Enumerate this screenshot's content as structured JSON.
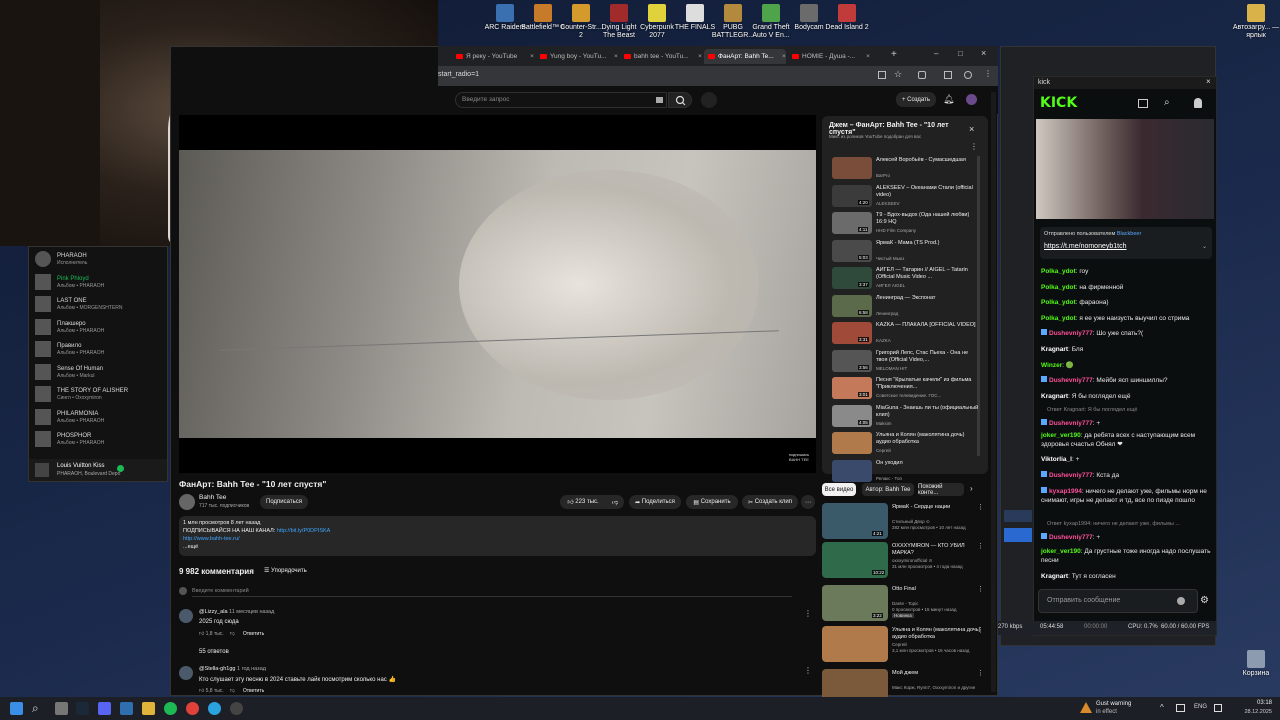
{
  "desktop": {
    "icons": [
      {
        "label": "ARC Raiders",
        "color": "#3a6fb0"
      },
      {
        "label": "Battlefield™ 6",
        "color": "#c77b2a"
      },
      {
        "label": "Counter-Str... 2",
        "color": "#d49a2b"
      },
      {
        "label": "Dying Light The Beast",
        "color": "#a12a2a"
      },
      {
        "label": "Cyberpunk 2077",
        "color": "#e0d23a"
      },
      {
        "label": "THE FINALS",
        "color": "#dddddd"
      },
      {
        "label": "PUBG BATTLEGR...",
        "color": "#b38a3d"
      },
      {
        "label": "Grand Theft Auto V En...",
        "color": "#4fa34a"
      },
      {
        "label": "Bodycam",
        "color": "#6b6b6b"
      },
      {
        "label": "Dead Island 2",
        "color": "#c23b3b"
      }
    ],
    "right_icon_label": "Автозагру... — ярлык",
    "trash_label": "Корзина"
  },
  "spotify": {
    "items": [
      {
        "title": "PHARAOH",
        "sub": "Исполнитель"
      },
      {
        "title": "Pink Phloyd",
        "sub": "Альбом • PHARAOH"
      },
      {
        "title": "LAST ONE",
        "sub": "Альбом • MORGENSHTERN"
      },
      {
        "title": "Плакшеро",
        "sub": "Альбом • PHARAOH"
      },
      {
        "title": "Правило",
        "sub": "Альбом • PHARAOH"
      },
      {
        "title": "Sense Of Human",
        "sub": "Альбом • Markul"
      },
      {
        "title": "THE STORY OF ALISHER",
        "sub": "Сингл • Oxxxymiron"
      },
      {
        "title": "PHILARMONIA",
        "sub": "Альбом • PHARAOH"
      },
      {
        "title": "PHOSPHOR",
        "sub": "Альбом • PHARAOH"
      }
    ],
    "now_playing": {
      "title": "Louis Vuitton Kiss",
      "artist": "PHARAOH, Boulevard Depo"
    }
  },
  "browser": {
    "tabs": [
      {
        "label": "Я реку - YouTube"
      },
      {
        "label": "Yung boy - YouTu..."
      },
      {
        "label": "bahh tee - YouTu..."
      },
      {
        "label": "ФанАрт: Bahh Te...",
        "active": true
      },
      {
        "label": "HOMIE - Душа -..."
      }
    ],
    "url": "start_radio=1",
    "search_placeholder": "Введите запрос",
    "create_label": "Создать"
  },
  "video": {
    "title": "ФанАрт: Bahh Tee - \"10 лет спустя\"",
    "channel": "Bahh Tee",
    "subs": "717 тыс. подписчиков",
    "subscribe": "Подписаться",
    "likes": "223 тыс.",
    "share": "Поделиться",
    "save": "Сохранить",
    "clip": "Создать клип",
    "watermark": "подпишись BAHH TEE",
    "desc_meta": "1 млн просмотров  8 лет назад",
    "desc_line": "ПОДПИСЫВАЙСЯ НА НАШ КАНАЛ:",
    "desc_link1": "http://bit.ly/P0DPISKA",
    "desc_link2": "http://www.bahh-tee.ru/",
    "desc_more": "...ещё",
    "comments_count": "9 982 комментария",
    "sort": "Упорядочить",
    "add_comment": "Введите комментарий",
    "comments": [
      {
        "author": "@Lizzy_ala",
        "time": "11 месяцев назад",
        "text": "2025 год сюда",
        "likes": "1,8 тыс.",
        "reply": "Ответить",
        "replies": "55 ответов"
      },
      {
        "author": "@Stella-gh1gg",
        "time": "1 год назад",
        "text": "Кто слушает эту песню в 2024 ставьте лайк посмотрим сколько нас 👍",
        "likes": "5,8 тыс.",
        "reply": "Ответить"
      }
    ]
  },
  "playlist": {
    "title": "Джем – ФанАрт: Bahh Tee - \"10 лет спустя\"",
    "subtitle": "Микс из роликов YouTube подобран для вас",
    "items": [
      {
        "title": "Алексей Воробьёв - Сумасшедшая",
        "channel": "BarPro",
        "dur": "",
        "color": "#7a4c3a"
      },
      {
        "title": "ALEKSEEV – Океанами Стали (official video)",
        "channel": "ALEKSEEV",
        "dur": "4:20",
        "color": "#3b3b3b"
      },
      {
        "title": "T9 - Вдох-выдох (Ода нашей любви) 16:9 HQ",
        "channel": "HHD Film Company",
        "dur": "4:11",
        "color": "#6b6b6b"
      },
      {
        "title": "ЯрмаК - Мама (TS Prod.)",
        "channel": "Чистый Мьюз",
        "dur": "5:03",
        "color": "#4a4a4a"
      },
      {
        "title": "АИГЕЛ — Татарин // AIGEL – Tatarin (Official Music Video ...",
        "channel": "АИГЕЛ AIGEL",
        "dur": "3:37",
        "color": "#2f4a3a"
      },
      {
        "title": "Ленинград — Экспонат",
        "channel": "Ленинград",
        "dur": "6:58",
        "color": "#5a6a4a"
      },
      {
        "title": "KAZKA — ПЛАКАЛА [OFFICIAL VIDEO]",
        "channel": "KAZKA",
        "dur": "3:31",
        "color": "#a04a3a"
      },
      {
        "title": "Григорий Лепс, Стас Пьеха - Она не твоя (Official Video,...",
        "channel": "MELOMAN HIT",
        "dur": "3:56",
        "color": "#555"
      },
      {
        "title": "Песня \"Крылатые качели\" из фильма \"Приключения...",
        "channel": "Советское телевидение. ГОС...",
        "dur": "3:01",
        "color": "#c47a5a"
      },
      {
        "title": "MiaGuna - Знаешь ли ты (официальный клип)",
        "channel": "Maksim",
        "dur": "4:05",
        "color": "#8a8a8a"
      },
      {
        "title": "Ульяна и Колян (маколятина дочь) аудио обработка",
        "channel": "Сергей",
        "dur": "",
        "color": "#b07a4a"
      },
      {
        "title": "Он уходил",
        "channel": "Релакс - Топ",
        "dur": "",
        "color": "#3a4a6a"
      }
    ]
  },
  "recommend": {
    "chips": [
      "Все видео",
      "Автор: Bahh Tee",
      "Похожий конте..."
    ],
    "items": [
      {
        "title": "ЯрмаК - Сердце нации",
        "meta1": "Стильный Двор ⊙",
        "meta2": "282 млн просмотров • 10 лет назад",
        "dur": "4:21",
        "color": "#3a5a6a"
      },
      {
        "title": "OXXXYMIRON — КТО УБИЛ МАРКА?",
        "meta1": "oxxxymironofficial ⊙",
        "meta2": "31 млн просмотров • 4 года назад",
        "dur": "10:22",
        "color": "#2f6a4a"
      },
      {
        "title": "Otto Final",
        "meta1": "Dante - Topic",
        "meta2": "0 просмотров • 15 минут назад",
        "dur": "3:22",
        "color": "#6a7a5a",
        "badge": "Новинка"
      },
      {
        "title": "Ульяна и Колян (маколятина дочь) аудио обработка",
        "meta1": "Сергей",
        "meta2": "3,1 млн просмотров • 16 часов назад",
        "dur": "",
        "color": "#b07a4a"
      },
      {
        "title": "Мой джем",
        "meta1": "Макс Корж, Rynn7, Oxxxymiron и другие",
        "meta2": "",
        "dur": "",
        "color": "#7a5a3a"
      }
    ]
  },
  "kick": {
    "window_title": "kick",
    "brand": "KICK",
    "pinned_label": "Отправлено пользователем",
    "pinned_user": "Blackbeer",
    "pinned_link": "https://t.me/nomoneyb1tch",
    "messages": [
      {
        "user": "Polka_ydot",
        "color": "g",
        "text": "гоу"
      },
      {
        "user": "Polka_ydot",
        "color": "g",
        "text": "на фирменной"
      },
      {
        "user": "Polka_ydot",
        "color": "g",
        "text": "фараона)"
      },
      {
        "user": "Polka_ydot",
        "color": "g",
        "text": "я ее уже наизусть выучил со стрима"
      },
      {
        "user": "Dushevniy777",
        "color": "p",
        "text": "Шо уже спать?("
      },
      {
        "user": "Kragnart",
        "color": "w",
        "text": "Бля"
      },
      {
        "user": "Winzer",
        "color": "g",
        "text": "🟢"
      },
      {
        "user": "Dushevniy777",
        "color": "p",
        "text": "Мейби ясп шиншиллы?"
      },
      {
        "user": "Kragnart",
        "color": "w",
        "text": "Я бы поглядел ещё"
      },
      {
        "reply": "Ответ Kragnart: Я бы поглядел ещё"
      },
      {
        "user": "Dushevniy777",
        "color": "p",
        "text": "+"
      },
      {
        "user": "joker_ver190",
        "color": "g",
        "text": "да ребята всех с наступающим всем здоровья счастья Обнял ❤"
      },
      {
        "user": "Viktorlia_I",
        "color": "w",
        "text": "+"
      },
      {
        "user": "Dushevniy777",
        "color": "p",
        "text": "Кста да"
      },
      {
        "user": "kyxap1994",
        "color": "p",
        "text": "ничего не делают уже, фильмы норм не снимают, игры не делают и тд, все по пизде пошло"
      },
      {
        "reply": "Ответ kyxap1994: ничего не делают уже, фильмы ..."
      },
      {
        "user": "Dushevniy777",
        "color": "p",
        "text": "+"
      },
      {
        "user": "joker_ver190",
        "color": "g",
        "text": "Да грустные тоже иногда надо послушать песни"
      },
      {
        "user": "Kragnart",
        "color": "w",
        "text": "Тут я согласен"
      }
    ],
    "input_placeholder": "Отправить сообщение"
  },
  "obs": {
    "kbps": "270 kbps",
    "time1": "05:44:58",
    "time2": "00:00:00",
    "cpu": "CPU: 0.7%",
    "fps": "60.00 / 60.00 FPS"
  },
  "taskbar": {
    "warning_title": "Gust warning",
    "warning_sub": "in effect",
    "lang": "ENG",
    "time": "03:18",
    "date": "28.12.2025"
  }
}
